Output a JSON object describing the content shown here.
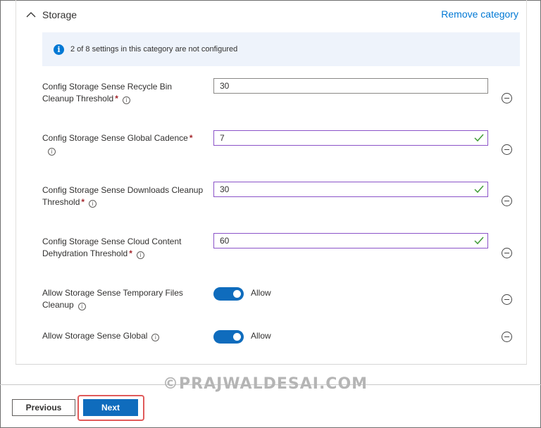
{
  "section": {
    "title": "Storage",
    "remove_label": "Remove category"
  },
  "info_bar": {
    "text": "2 of 8 settings in this category are not configured"
  },
  "settings": [
    {
      "label": "Config Storage Sense Recycle Bin Cleanup Threshold",
      "required": true,
      "value": "30",
      "validated": false
    },
    {
      "label": "Config Storage Sense Global Cadence",
      "required": true,
      "value": "7",
      "validated": true
    },
    {
      "label": "Config Storage Sense Downloads Cleanup Threshold",
      "required": true,
      "value": "30",
      "validated": true
    },
    {
      "label": "Config Storage Sense Cloud Content Dehydration Threshold",
      "required": true,
      "value": "60",
      "validated": true
    },
    {
      "label": "Allow Storage Sense Temporary Files Cleanup",
      "toggle_on": true,
      "toggle_label": "Allow"
    },
    {
      "label": "Allow Storage Sense Global",
      "toggle_on": true,
      "toggle_label": "Allow"
    }
  ],
  "required_marker": "*",
  "tooltip_glyph": "i",
  "watermark": "©PRAJWALDESAI.COM",
  "footer": {
    "previous_label": "Previous",
    "next_label": "Next"
  },
  "colors": {
    "accent": "#0f6cbd",
    "link": "#0078d4",
    "info_bg": "#eef3fb",
    "valid_border": "#8b53c8",
    "check": "#3f9c35",
    "required": "#a4262c",
    "highlight": "#e05a5a"
  }
}
